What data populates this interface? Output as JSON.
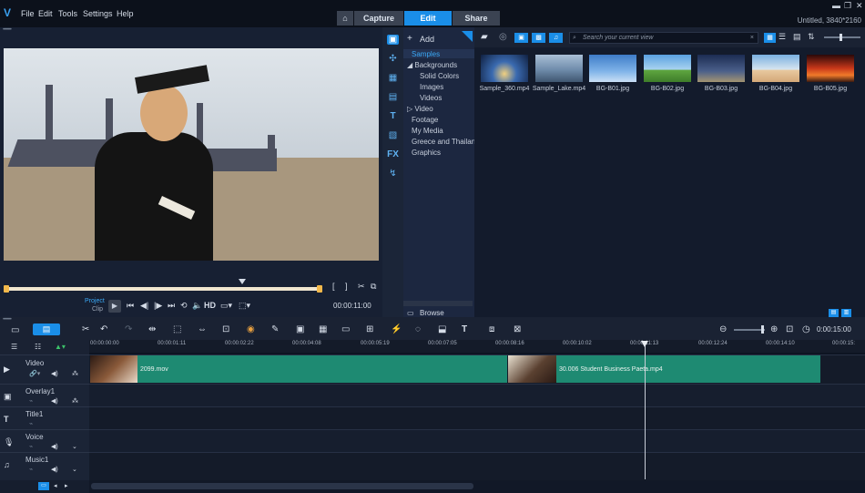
{
  "menu": [
    "File",
    "Edit",
    "Tools",
    "Settings",
    "Help"
  ],
  "modes": {
    "capture": "Capture",
    "edit": "Edit",
    "share": "Share"
  },
  "project_info": "Untitled, 3840*2160",
  "preview": {
    "project_label": "Project",
    "clip_label": "Clip",
    "hd_label": "HD",
    "timecode": "00:00:11:00"
  },
  "library": {
    "add_label": "Add",
    "search_placeholder": "Search your current view",
    "browse_label": "Browse",
    "tree": [
      "Samples",
      "Backgrounds",
      "Solid Colors",
      "Images",
      "Videos",
      "Video",
      "Footage",
      "My Media",
      "Greece and Thailan",
      "Graphics"
    ],
    "items": [
      {
        "name": "Sample_360.mp4"
      },
      {
        "name": "Sample_Lake.mp4"
      },
      {
        "name": "BG-B01.jpg"
      },
      {
        "name": "BG-B02.jpg"
      },
      {
        "name": "BG-B03.jpg"
      },
      {
        "name": "BG-B04.jpg"
      },
      {
        "name": "BG-B05.jpg"
      }
    ]
  },
  "timeline": {
    "zoom_timecode": "0:00:15:00",
    "ruler": [
      "00:00:00:00",
      "00:00:01:11",
      "00:00:02:22",
      "00:00:04:08",
      "00:00:05:19",
      "00:00:07:05",
      "00:00:08:16",
      "00:00:10:02",
      "00:00:11:13",
      "00:00:12:24",
      "00:00:14:10",
      "00:00:15:"
    ],
    "tracks": [
      "Video",
      "Overlay1",
      "Title1",
      "Voice",
      "Music1"
    ],
    "clips": [
      {
        "name": "2099.mov"
      },
      {
        "name": "30.006 Student Business Paeta.mp4"
      }
    ],
    "playhead_seconds": 11.4
  }
}
